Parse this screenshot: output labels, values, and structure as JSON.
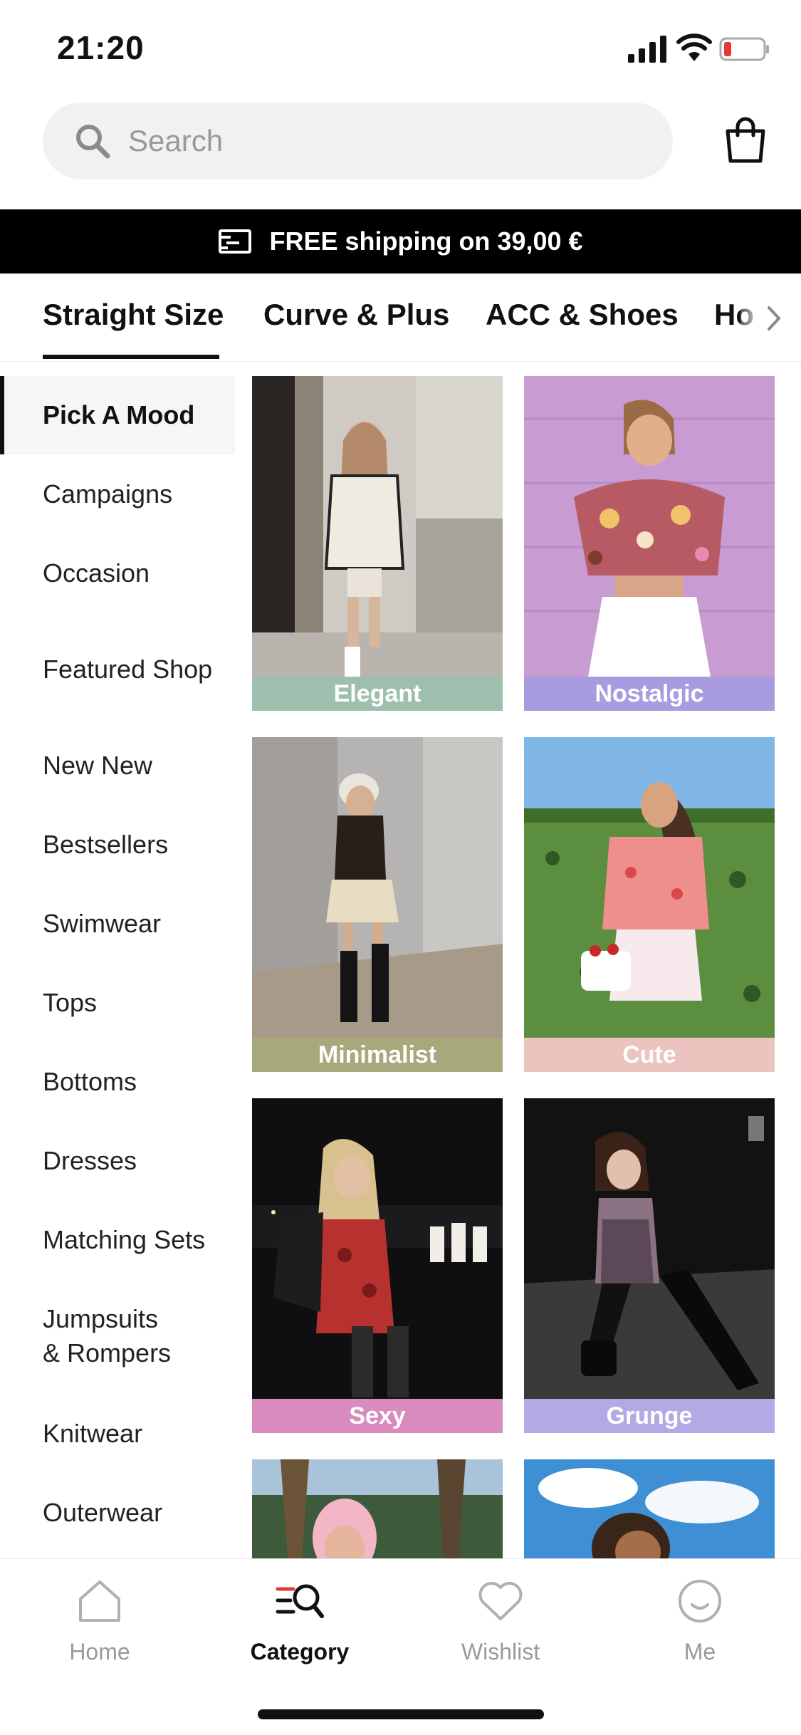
{
  "status_bar": {
    "time": "21:20"
  },
  "search": {
    "placeholder": "Search"
  },
  "shipping_banner": {
    "text": "FREE shipping on 39,00 €"
  },
  "tabs": [
    {
      "label": "Straight Size",
      "active": true
    },
    {
      "label": "Curve & Plus",
      "active": false
    },
    {
      "label": "ACC & Shoes",
      "active": false
    },
    {
      "label": "Ho",
      "active": false
    }
  ],
  "sidebar": {
    "items": [
      {
        "label": "Pick A Mood",
        "active": true
      },
      {
        "label": "Campaigns"
      },
      {
        "label": "Occasion"
      },
      {
        "label": "Featured Shop"
      },
      {
        "label": "New New"
      },
      {
        "label": "Bestsellers"
      },
      {
        "label": "Swimwear"
      },
      {
        "label": "Tops"
      },
      {
        "label": "Bottoms"
      },
      {
        "label": "Dresses"
      },
      {
        "label": "Matching Sets"
      },
      {
        "label": "Jumpsuits"
      },
      {
        "label": "& Rompers"
      },
      {
        "label": "Knitwear"
      },
      {
        "label": "Outerwear"
      }
    ]
  },
  "moods": [
    {
      "label": "Elegant",
      "label_color": "#9fbfae"
    },
    {
      "label": "Nostalgic",
      "label_color": "#a89be0"
    },
    {
      "label": "Minimalist",
      "label_color": "#a7a97c"
    },
    {
      "label": "Cute",
      "label_color": "#ebc4c0"
    },
    {
      "label": "Sexy",
      "label_color": "#d98bbd"
    },
    {
      "label": "Grunge",
      "label_color": "#b3a9e4"
    }
  ],
  "bottom_nav": [
    {
      "label": "Home",
      "icon": "home-icon"
    },
    {
      "label": "Category",
      "icon": "category-icon",
      "active": true
    },
    {
      "label": "Wishlist",
      "icon": "heart-icon"
    },
    {
      "label": "Me",
      "icon": "profile-icon"
    }
  ]
}
